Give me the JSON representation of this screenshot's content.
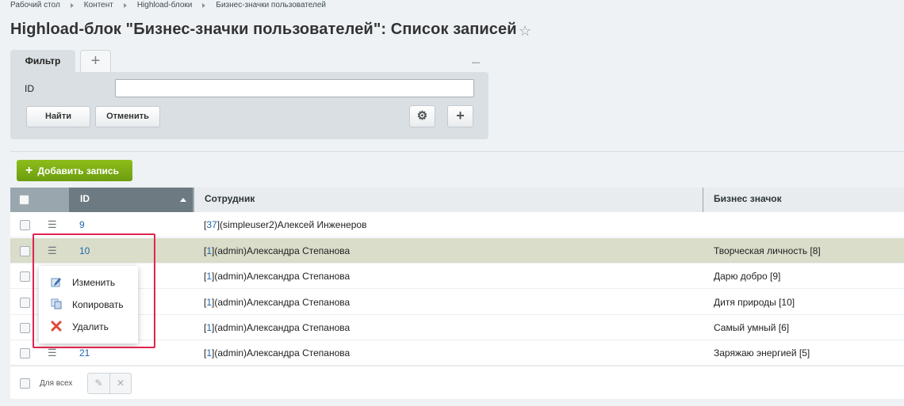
{
  "breadcrumb": [
    "Рабочий стол",
    "Контент",
    "Highload-блоки",
    "Бизнес-значки пользователей"
  ],
  "page_title": "Highload-блок \"Бизнес-значки пользователей\": Список записей",
  "filter": {
    "tab_label": "Фильтр",
    "add_tab": "+",
    "minimize": "–",
    "id_label": "ID",
    "id_value": "",
    "find_label": "Найти",
    "cancel_label": "Отменить",
    "gear": "⚙",
    "plus": "+"
  },
  "add_button_label": "Добавить запись",
  "table": {
    "headers": [
      "ID",
      "Сотрудник",
      "Бизнес значок"
    ],
    "rows": [
      {
        "id": "9",
        "uid": "37",
        "emp": "(simpleuser2)Алексей Инженеров",
        "badge": ""
      },
      {
        "id": "10",
        "uid": "1",
        "emp": "(admin)Александра Степанова",
        "badge": "Творческая личность [8]"
      },
      {
        "id": "",
        "uid": "1",
        "emp": "(admin)Александра Степанова",
        "badge": "Дарю добро [9]"
      },
      {
        "id": "",
        "uid": "1",
        "emp": "(admin)Александра Степанова",
        "badge": "Дитя природы [10]"
      },
      {
        "id": "",
        "uid": "1",
        "emp": "(admin)Александра Степанова",
        "badge": "Самый умный [6]"
      },
      {
        "id": "21",
        "uid": "1",
        "emp": "(admin)Александра Степанова",
        "badge": "Заряжаю энергией [5]"
      }
    ],
    "footer_label": "Для всех"
  },
  "context_menu": {
    "items": [
      "Изменить",
      "Копировать",
      "Удалить"
    ]
  },
  "colors": {
    "accent_green": "#7aad12",
    "link_blue": "#2067b0",
    "highlight_red": "#e0244e"
  }
}
